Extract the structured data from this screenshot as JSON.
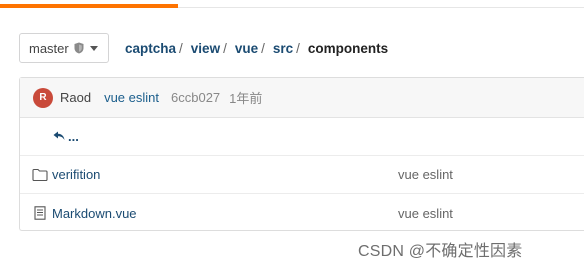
{
  "branch": {
    "name": "master"
  },
  "breadcrumb": {
    "items": [
      "captcha",
      "view",
      "vue",
      "src",
      "components"
    ],
    "separator": "/"
  },
  "commit": {
    "avatar_initial": "R",
    "author": "Raod",
    "message": "vue eslint",
    "sha": "6ccb027",
    "time": "1年前"
  },
  "parent_link": {
    "label": "..."
  },
  "files": [
    {
      "type": "folder",
      "icon": "folder-icon",
      "name": "verifition",
      "last_commit": "vue eslint"
    },
    {
      "type": "file",
      "icon": "file-text-icon",
      "name": "Markdown.vue",
      "last_commit": "vue eslint"
    }
  ],
  "watermark": "CSDN @不确定性因素",
  "colors": {
    "accent": "#fe7300",
    "link": "#1b4b72",
    "avatar": "#c94a3a"
  }
}
